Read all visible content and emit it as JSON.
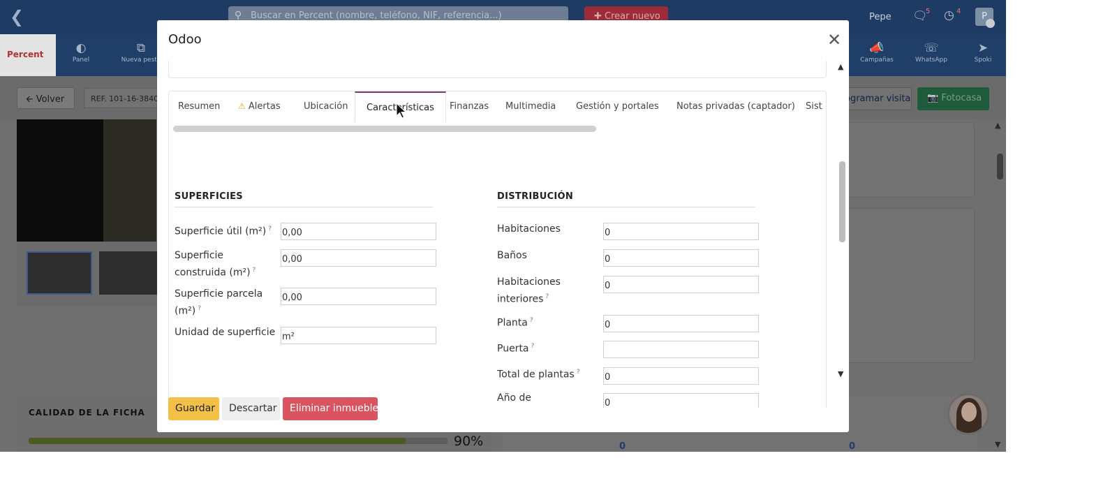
{
  "topbar": {
    "search_placeholder": "Buscar en Percent (nombre, teléfono, NIF, referencia...)",
    "create_label": "Crear nuevo",
    "user_name": "Pepe",
    "messages_count": "5",
    "activities_count": "4",
    "avatar_initial": "P"
  },
  "nav": {
    "logo": "Percent",
    "items": [
      {
        "label": "Panel",
        "icon": "dashboard-icon"
      },
      {
        "label": "Nueva pesta",
        "icon": "new-tab-icon"
      },
      {
        "label": "Campañas",
        "icon": "megaphone-icon"
      },
      {
        "label": "WhatsApp",
        "icon": "whatsapp-icon"
      },
      {
        "label": "Spoki",
        "icon": "paper-plane-icon"
      }
    ]
  },
  "subbar": {
    "back_label": "Volver",
    "ref_label": "REF. 101-16-3840",
    "schedule_label": "ogramar visita",
    "fotocasa_label": "Fotocasa"
  },
  "quality": {
    "label": "CALIDAD DE LA FICHA",
    "percent_text": "90%",
    "percent_value": 0.9
  },
  "stats": {
    "left_value": "0",
    "right_value": "0"
  },
  "modal": {
    "title": "Odoo",
    "tabs": [
      {
        "label": "Resumen",
        "icon": ""
      },
      {
        "label": "Alertas",
        "icon": "warning-icon"
      },
      {
        "label": "Ubicación",
        "icon": ""
      },
      {
        "label": "Características",
        "icon": "",
        "active": true
      },
      {
        "label": "Finanzas",
        "icon": ""
      },
      {
        "label": "Multimedia",
        "icon": ""
      },
      {
        "label": "Gestión y portales",
        "icon": ""
      },
      {
        "label": "Notas privadas (captador)",
        "icon": ""
      },
      {
        "label": "Sist",
        "icon": ""
      }
    ],
    "superficies": {
      "title": "SUPERFICIES",
      "fields": [
        {
          "label": "Superficie útil (m²)",
          "help": "?",
          "value": "0,00"
        },
        {
          "label": "Superficie construida (m²)",
          "help": "?",
          "value": "0,00"
        },
        {
          "label": "Superficie parcela (m²)",
          "help": "?",
          "value": "0,00"
        },
        {
          "label": "Unidad de superficie",
          "help": "",
          "value": "m²"
        }
      ]
    },
    "distribucion": {
      "title": "DISTRIBUCIÓN",
      "fields": [
        {
          "label": "Habitaciones",
          "help": "",
          "value": "0"
        },
        {
          "label": "Baños",
          "help": "",
          "value": "0"
        },
        {
          "label": "Habitaciones interiores",
          "help": "?",
          "value": "0"
        },
        {
          "label": "Planta",
          "help": "?",
          "value": "0"
        },
        {
          "label": "Puerta",
          "help": "?",
          "value": ""
        },
        {
          "label": "Total de plantas",
          "help": "?",
          "value": "0"
        },
        {
          "label": "Año de",
          "help": "",
          "value": "0"
        }
      ]
    },
    "buttons": {
      "save": "Guardar",
      "discard": "Descartar",
      "delete": "Eliminar inmueble"
    }
  },
  "colors": {
    "topbar": "#1d3b63",
    "tab_active_border": "#7c3d7a",
    "save_button": "#f4c046",
    "delete_button": "#d9545f"
  }
}
